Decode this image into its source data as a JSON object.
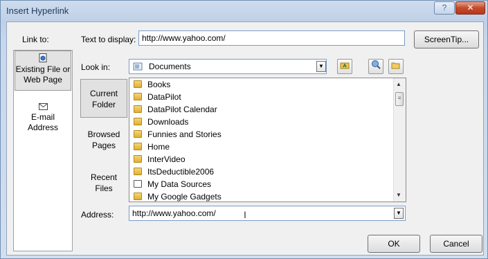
{
  "window": {
    "title": "Insert Hyperlink",
    "help_glyph": "?",
    "close_glyph": "✕"
  },
  "link_to": {
    "label": "Link to:",
    "items": [
      {
        "line1": "Existing File or",
        "line2": "Web Page",
        "icon": "web-page-icon",
        "selected": true
      },
      {
        "line1": "E-mail",
        "line2": "Address",
        "icon": "email-icon",
        "selected": false
      }
    ]
  },
  "text_to_display": {
    "label": "Text to display:",
    "value": "http://www.yahoo.com/"
  },
  "screentip_label": "ScreenTip...",
  "look_in": {
    "label": "Look in:",
    "value": "Documents"
  },
  "places": [
    {
      "line1": "Current",
      "line2": "Folder",
      "selected": true
    },
    {
      "line1": "Browsed",
      "line2": "Pages",
      "selected": false
    },
    {
      "line1": "Recent",
      "line2": "Files",
      "selected": false
    }
  ],
  "files": [
    {
      "name": "Books",
      "type": "folder"
    },
    {
      "name": "DataPilot",
      "type": "folder"
    },
    {
      "name": "DataPilot Calendar",
      "type": "folder"
    },
    {
      "name": "Downloads",
      "type": "folder"
    },
    {
      "name": "Funnies and Stories",
      "type": "folder"
    },
    {
      "name": "Home",
      "type": "folder"
    },
    {
      "name": "InterVideo",
      "type": "folder"
    },
    {
      "name": "ItsDeductible2006",
      "type": "folder"
    },
    {
      "name": "My Data Sources",
      "type": "data-folder"
    },
    {
      "name": "My Google Gadgets",
      "type": "folder"
    }
  ],
  "address": {
    "label": "Address:",
    "value": "http://www.yahoo.com/"
  },
  "buttons": {
    "ok": "OK",
    "cancel": "Cancel"
  }
}
